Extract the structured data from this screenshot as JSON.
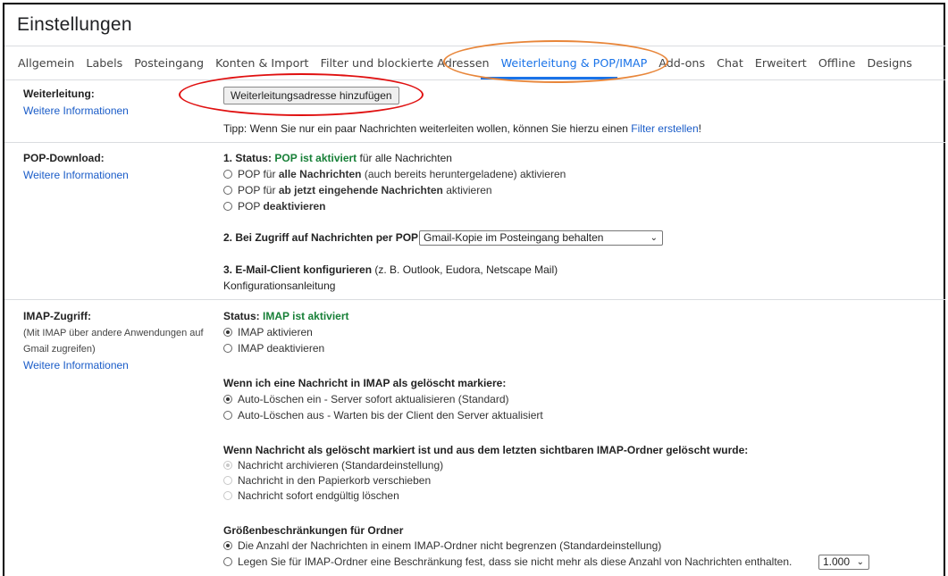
{
  "page_title": "Einstellungen",
  "tabs": [
    {
      "label": "Allgemein"
    },
    {
      "label": "Labels"
    },
    {
      "label": "Posteingang"
    },
    {
      "label": "Konten & Import"
    },
    {
      "label": "Filter und blockierte Adressen"
    },
    {
      "label": "Weiterleitung & POP/IMAP"
    },
    {
      "label": "Add-ons"
    },
    {
      "label": "Chat"
    },
    {
      "label": "Erweitert"
    },
    {
      "label": "Offline"
    },
    {
      "label": "Designs"
    }
  ],
  "forwarding": {
    "label": "Weiterleitung:",
    "more_info": "Weitere Informationen",
    "button": "Weiterleitungsadresse hinzufügen",
    "tip": "Tipp: Wenn Sie nur ein paar Nachrichten weiterleiten wollen, können Sie hierzu einen",
    "tip_link": "Filter erstellen",
    "tip_end": "!"
  },
  "pop": {
    "label": "POP-Download:",
    "more_info": "Weitere Informationen",
    "status_prefix": "1. Status:",
    "status_value": "POP ist aktiviert",
    "status_suffix": "für alle Nachrichten",
    "opt1_a": "POP für",
    "opt1_b": "alle Nachrichten",
    "opt1_c": "(auch bereits heruntergeladene) aktivieren",
    "opt2_a": "POP für",
    "opt2_b": "ab jetzt eingehende Nachrichten",
    "opt2_c": "aktivieren",
    "opt3_a": "POP",
    "opt3_b": "deaktivieren",
    "access_label": "2. Bei Zugriff auf Nachrichten per POP",
    "access_select": "Gmail-Kopie im Posteingang behalten",
    "client_label": "3. E-Mail-Client konfigurieren",
    "client_hint": "(z. B. Outlook, Eudora, Netscape Mail)",
    "config_link": "Konfigurationsanleitung"
  },
  "imap": {
    "label": "IMAP-Zugriff:",
    "sub1": "(Mit IMAP über andere Anwendungen auf",
    "sub2": "Gmail zugreifen)",
    "more_info": "Weitere Informationen",
    "status_prefix": "Status:",
    "status_value": "IMAP ist aktiviert",
    "enable": "IMAP aktivieren",
    "disable": "IMAP deaktivieren",
    "deleted_heading": "Wenn ich eine Nachricht in IMAP als gelöscht markiere:",
    "expunge_on": "Auto-Löschen ein - Server sofort aktualisieren (Standard)",
    "expunge_off": "Auto-Löschen aus - Warten bis der Client den Server aktualisiert",
    "expunged_heading": "Wenn Nachricht als gelöscht markiert ist und aus dem letzten sichtbaren IMAP-Ordner gelöscht wurde:",
    "archive": "Nachricht archivieren (Standardeinstellung)",
    "trash": "Nachricht in den Papierkorb verschieben",
    "delete_forever": "Nachricht sofort endgültig löschen",
    "size_heading": "Größenbeschränkungen für Ordner",
    "no_limit": "Die Anzahl der Nachrichten in einem IMAP-Ordner nicht begrenzen (Standardeinstellung)",
    "limit": "Legen Sie für IMAP-Ordner eine Beschränkung fest, dass sie nicht mehr als diese Anzahl von Nachrichten enthalten.",
    "limit_select": "1.000"
  },
  "colors": {
    "accent": "#1a73e8",
    "link": "#1a5cc8",
    "status_green": "#188038",
    "annotation_red": "#e01010",
    "annotation_orange": "#e8863a"
  }
}
